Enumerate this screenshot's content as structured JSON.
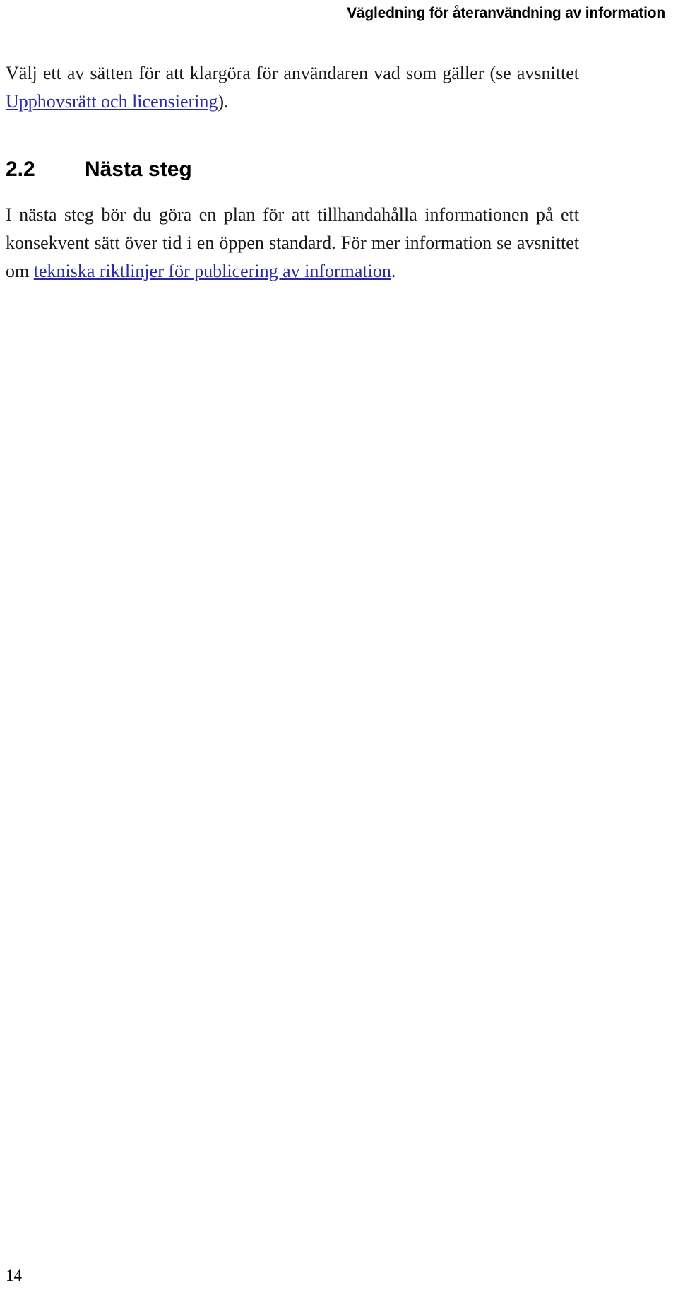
{
  "document": {
    "running_header": "Vägledning för återanvändning av information",
    "page_number": "14"
  },
  "paragraphs": {
    "intro": {
      "before_link": "Välj ett av sätten för att klargöra för användaren vad som gäller (se avsnittet ",
      "link_text": "Upphovsrätt och licensiering",
      "after_link": ")."
    },
    "next_steps": {
      "before_link": "I nästa steg bör du göra en plan för att tillhandahålla informationen på ett konsekvent sätt över tid i en öppen standard. För mer information se avsnittet om ",
      "link_text": "tekniska riktlinjer för publicering av information",
      "after_link": "."
    }
  },
  "heading": {
    "number": "2.2",
    "title": "Nästa steg"
  },
  "colors": {
    "link": "#2a2aa5",
    "text": "#1a1a1a",
    "background": "#ffffff"
  }
}
